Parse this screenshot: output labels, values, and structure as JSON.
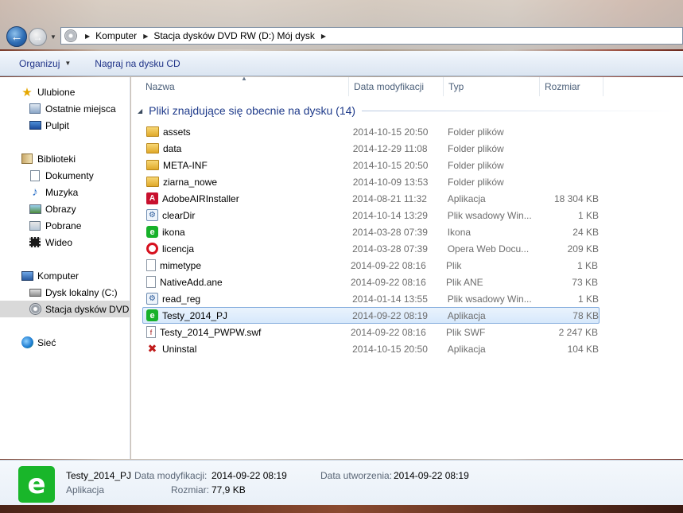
{
  "address": {
    "crumbs": [
      "Komputer",
      "Stacja dysków DVD RW (D:) Mój dysk"
    ]
  },
  "toolbar": {
    "organize_label": "Organizuj",
    "burn_label": "Nagraj na dysku CD"
  },
  "navpane": {
    "favorites": "Ulubione",
    "recent": "Ostatnie miejsca",
    "desktop": "Pulpit",
    "libraries": "Biblioteki",
    "documents": "Dokumenty",
    "music": "Muzyka",
    "pictures": "Obrazy",
    "downloads": "Pobrane",
    "videos": "Wideo",
    "computer": "Komputer",
    "local_disk": "Dysk lokalny (C:)",
    "dvd_drive": "Stacja dysków DVD R",
    "network": "Sieć"
  },
  "columns": {
    "name": "Nazwa",
    "date": "Data modyfikacji",
    "type": "Typ",
    "size": "Rozmiar"
  },
  "group_header": "Pliki znajdujące się obecnie na dysku (14)",
  "files": [
    {
      "name": "assets",
      "date": "2014-10-15 20:50",
      "type": "Folder plików",
      "size": "",
      "icon": "folder-icon"
    },
    {
      "name": "data",
      "date": "2014-12-29 11:08",
      "type": "Folder plików",
      "size": "",
      "icon": "folder-icon"
    },
    {
      "name": "META-INF",
      "date": "2014-10-15 20:50",
      "type": "Folder plików",
      "size": "",
      "icon": "folder-icon"
    },
    {
      "name": "ziarna_nowe",
      "date": "2014-10-09 13:53",
      "type": "Folder plików",
      "size": "",
      "icon": "folder-icon"
    },
    {
      "name": "AdobeAIRInstaller",
      "date": "2014-08-21 11:32",
      "type": "Aplikacja",
      "size": "18 304 KB",
      "icon": "adobe-air-icon"
    },
    {
      "name": "clearDir",
      "date": "2014-10-14 13:29",
      "type": "Plik wsadowy Win...",
      "size": "1 KB",
      "icon": "batch-file-icon"
    },
    {
      "name": "ikona",
      "date": "2014-03-28 07:39",
      "type": "Ikona",
      "size": "24 KB",
      "icon": "e-app-icon"
    },
    {
      "name": "licencja",
      "date": "2014-03-28 07:39",
      "type": "Opera Web Docu...",
      "size": "209 KB",
      "icon": "opera-icon"
    },
    {
      "name": "mimetype",
      "date": "2014-09-22 08:16",
      "type": "Plik",
      "size": "1 KB",
      "icon": "blank-file-icon"
    },
    {
      "name": "NativeAdd.ane",
      "date": "2014-09-22 08:16",
      "type": "Plik ANE",
      "size": "73 KB",
      "icon": "blank-file-icon"
    },
    {
      "name": "read_reg",
      "date": "2014-01-14 13:55",
      "type": "Plik wsadowy Win...",
      "size": "1 KB",
      "icon": "batch-file-icon"
    },
    {
      "name": "Testy_2014_PJ",
      "date": "2014-09-22 08:19",
      "type": "Aplikacja",
      "size": "78 KB",
      "icon": "e-app-icon",
      "selected": true
    },
    {
      "name": "Testy_2014_PWPW.swf",
      "date": "2014-09-22 08:16",
      "type": "Plik SWF",
      "size": "2 247 KB",
      "icon": "swf-file-icon"
    },
    {
      "name": "Uninstal",
      "date": "2014-10-15 20:50",
      "type": "Aplikacja",
      "size": "104 KB",
      "icon": "uninstall-icon"
    }
  ],
  "details": {
    "name": "Testy_2014_PJ",
    "type": "Aplikacja",
    "modified_label": "Data modyfikacji:",
    "modified_value": "2014-09-22 08:19",
    "created_label": "Data utworzenia:",
    "created_value": "2014-09-22 08:19",
    "size_label": "Rozmiar:",
    "size_value": "77,9 KB"
  },
  "colors": {
    "selection_border": "#84acdd",
    "link_blue": "#1e3287",
    "app_green": "#19b62a"
  }
}
